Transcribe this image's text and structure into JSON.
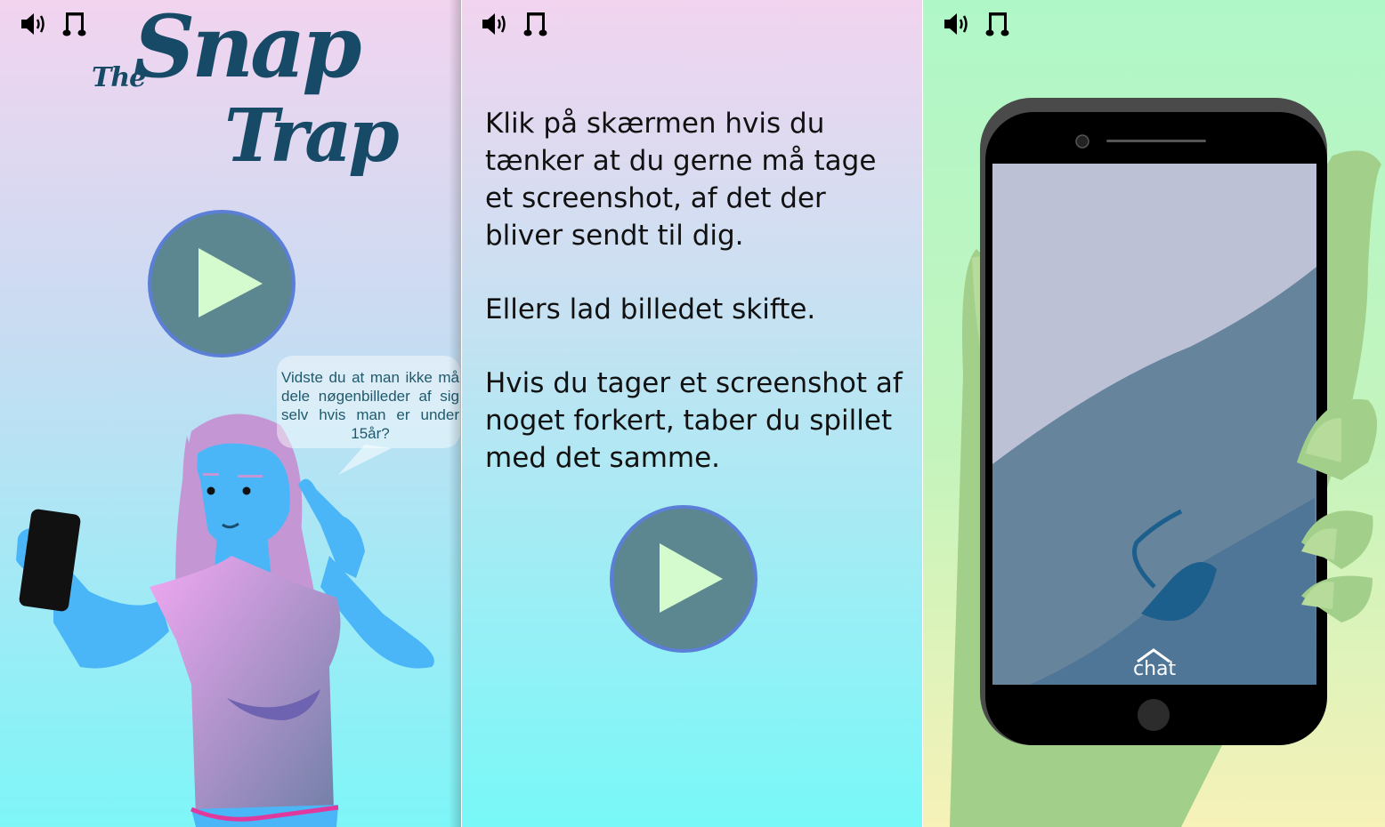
{
  "title": {
    "prefix": "The",
    "line1": "Snap",
    "line2": "Trap"
  },
  "start_screen": {
    "tip_bubble": "Vidste du at man ikke må dele nøgenbilleder af sig selv hvis man er under 15år?"
  },
  "instructions": {
    "paragraphs": [
      "Klik på skærmen hvis du tænker at du gerne må tage et screenshot, af det der bliver sendt til dig.",
      "Ellers lad billedet skifte.",
      "Hvis du tager et screenshot af noget forkert, taber du spillet med det samme."
    ]
  },
  "phone": {
    "chat_label": "chat"
  },
  "icons": {
    "sound": "speaker-icon",
    "music": "music-note-icon",
    "play": "play-icon",
    "chat_arrow": "chevron-up-icon"
  },
  "colors": {
    "title": "#174a66",
    "play_circle": "#5c8690",
    "play_ring": "#5b7fd6",
    "play_triangle": "#d3fbcd"
  }
}
